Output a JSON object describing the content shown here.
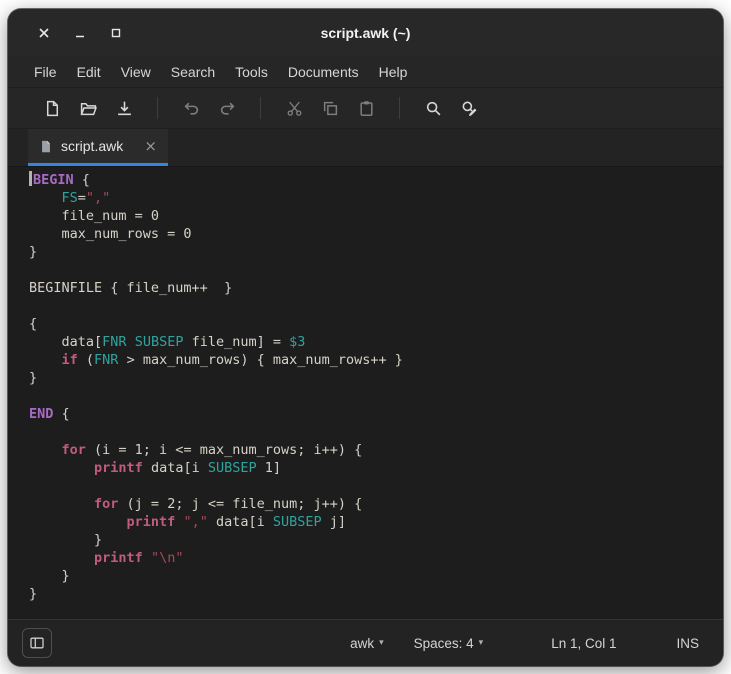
{
  "window": {
    "title": "script.awk (~)",
    "controls": [
      "close",
      "minimize",
      "maximize"
    ]
  },
  "menu": {
    "items": [
      "File",
      "Edit",
      "View",
      "Search",
      "Tools",
      "Documents",
      "Help"
    ]
  },
  "toolbar": {
    "groups": [
      {
        "buttons": [
          {
            "icon": "new-document",
            "state": "normal"
          },
          {
            "icon": "open-document",
            "state": "normal"
          },
          {
            "icon": "save-document",
            "state": "normal"
          }
        ]
      },
      {
        "buttons": [
          {
            "icon": "undo",
            "state": "dim"
          },
          {
            "icon": "redo",
            "state": "dim"
          }
        ]
      },
      {
        "buttons": [
          {
            "icon": "cut",
            "state": "dim"
          },
          {
            "icon": "copy",
            "state": "dim"
          },
          {
            "icon": "paste",
            "state": "dim"
          }
        ]
      },
      {
        "buttons": [
          {
            "icon": "search",
            "state": "normal"
          },
          {
            "icon": "find-replace",
            "state": "normal"
          }
        ]
      }
    ]
  },
  "tabbar": {
    "tabs": [
      {
        "label": "script.awk",
        "active": true,
        "close_glyph": "×"
      }
    ]
  },
  "editor": {
    "caret_line": 0,
    "syntax_colors": {
      "d": "#d6d2c8",
      "kw": "#a96bc6",
      "fl": "#c25b7c",
      "fn": "#2fa49e",
      "st": "#a84a58"
    },
    "lines": [
      [
        {
          "t": "BEGIN",
          "c": "kw"
        },
        {
          "t": " {",
          "c": "d"
        }
      ],
      [
        {
          "t": "    ",
          "c": "d"
        },
        {
          "t": "FS",
          "c": "fn"
        },
        {
          "t": "=",
          "c": "d"
        },
        {
          "t": "\",\"",
          "c": "st"
        }
      ],
      [
        {
          "t": "    file_num = 0",
          "c": "d"
        }
      ],
      [
        {
          "t": "    max_num_rows = 0",
          "c": "d"
        }
      ],
      [
        {
          "t": "}",
          "c": "d"
        }
      ],
      [],
      [
        {
          "t": "BEGINFILE { file_num++  }",
          "c": "d"
        }
      ],
      [],
      [
        {
          "t": "{",
          "c": "d"
        }
      ],
      [
        {
          "t": "    data[",
          "c": "d"
        },
        {
          "t": "FNR",
          "c": "fn"
        },
        {
          "t": " ",
          "c": "d"
        },
        {
          "t": "SUBSEP",
          "c": "fn"
        },
        {
          "t": " file_num] = ",
          "c": "d"
        },
        {
          "t": "$3",
          "c": "fn"
        }
      ],
      [
        {
          "t": "    ",
          "c": "d"
        },
        {
          "t": "if",
          "c": "fl"
        },
        {
          "t": " (",
          "c": "d"
        },
        {
          "t": "FNR",
          "c": "fn"
        },
        {
          "t": " > max_num_rows) { max_num_rows++ }",
          "c": "d"
        }
      ],
      [
        {
          "t": "}",
          "c": "d"
        }
      ],
      [],
      [
        {
          "t": "END",
          "c": "kw"
        },
        {
          "t": " {",
          "c": "d"
        }
      ],
      [],
      [
        {
          "t": "    ",
          "c": "d"
        },
        {
          "t": "for",
          "c": "fl"
        },
        {
          "t": " (i = 1; i <= max_num_rows; i++) {",
          "c": "d"
        }
      ],
      [
        {
          "t": "        ",
          "c": "d"
        },
        {
          "t": "printf",
          "c": "fl"
        },
        {
          "t": " data[i ",
          "c": "d"
        },
        {
          "t": "SUBSEP",
          "c": "fn"
        },
        {
          "t": " 1]",
          "c": "d"
        }
      ],
      [],
      [
        {
          "t": "        ",
          "c": "d"
        },
        {
          "t": "for",
          "c": "fl"
        },
        {
          "t": " (j = 2; j <= file_num; j++) {",
          "c": "d"
        }
      ],
      [
        {
          "t": "            ",
          "c": "d"
        },
        {
          "t": "printf",
          "c": "fl"
        },
        {
          "t": " ",
          "c": "d"
        },
        {
          "t": "\",\"",
          "c": "st"
        },
        {
          "t": " data[i ",
          "c": "d"
        },
        {
          "t": "SUBSEP",
          "c": "fn"
        },
        {
          "t": " j]",
          "c": "d"
        }
      ],
      [
        {
          "t": "        }",
          "c": "d"
        }
      ],
      [
        {
          "t": "        ",
          "c": "d"
        },
        {
          "t": "printf",
          "c": "fl"
        },
        {
          "t": " ",
          "c": "d"
        },
        {
          "t": "\"\\n\"",
          "c": "st"
        }
      ],
      [
        {
          "t": "    }",
          "c": "d"
        }
      ],
      [
        {
          "t": "}",
          "c": "d"
        }
      ]
    ]
  },
  "statusbar": {
    "language": "awk",
    "spaces": "Spaces: 4",
    "position": "Ln 1, Col 1",
    "mode": "INS",
    "dropdown_glyph": "▾"
  },
  "colors": {
    "accent": "#3584e4",
    "editor_bg": "#1d1d1d",
    "chrome_bg": "#262626"
  }
}
